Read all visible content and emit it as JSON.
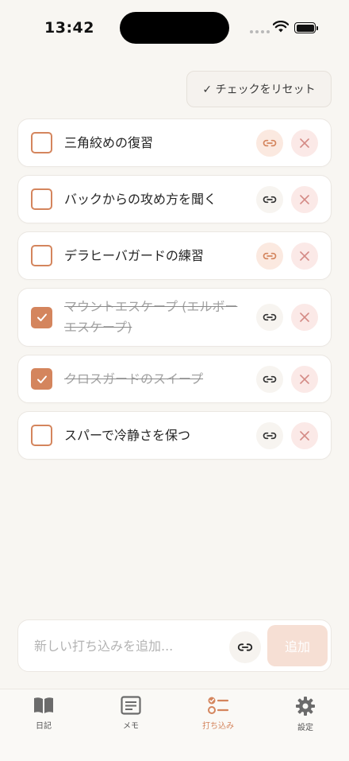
{
  "status_bar": {
    "time": "13:42"
  },
  "reset_button": {
    "label": "✓ チェックをリセット"
  },
  "items": [
    {
      "text": "三角絞めの復習",
      "checked": false,
      "has_link": true
    },
    {
      "text": "バックからの攻め方を聞く",
      "checked": false,
      "has_link": false
    },
    {
      "text": "デラヒーバガードの練習",
      "checked": false,
      "has_link": true
    },
    {
      "text": "マウントエスケープ (エルボーエスケープ)",
      "checked": true,
      "has_link": false
    },
    {
      "text": "クロスガードのスイープ",
      "checked": true,
      "has_link": false
    },
    {
      "text": "スパーで冷静さを保つ",
      "checked": false,
      "has_link": false
    }
  ],
  "add_bar": {
    "placeholder": "新しい打ち込みを追加...",
    "value": "",
    "add_label": "追加"
  },
  "tabs": [
    {
      "label": "日記",
      "icon": "book-icon",
      "active": false
    },
    {
      "label": "メモ",
      "icon": "note-icon",
      "active": false
    },
    {
      "label": "打ち込み",
      "icon": "checklist-icon",
      "active": true
    },
    {
      "label": "設定",
      "icon": "gear-icon",
      "active": false
    }
  ],
  "colors": {
    "accent": "#d4855d",
    "background": "#f8f6f2",
    "delete_bg": "#fbe9e7",
    "delete_icon": "#d48a85",
    "add_button_bg": "#f6dfd4"
  }
}
